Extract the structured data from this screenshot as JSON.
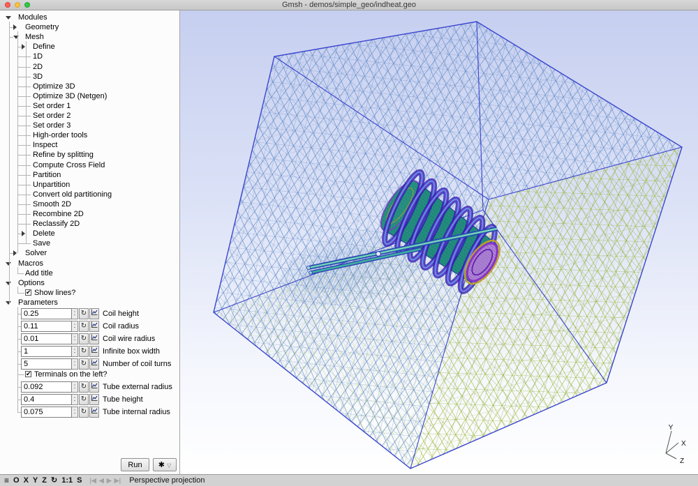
{
  "window": {
    "title": "Gmsh - demos/simple_geo/indheat.geo"
  },
  "icons": {
    "check": "✔",
    "stepper": ":",
    "loop": "↻",
    "gear": "✱",
    "dropdown": "▽",
    "menu": "≡"
  },
  "tree": {
    "items": [
      {
        "label": "Modules",
        "depth": 0,
        "arrow": "expanded"
      },
      {
        "label": "Geometry",
        "depth": 1,
        "arrow": "collapsed"
      },
      {
        "label": "Mesh",
        "depth": 1,
        "arrow": "expanded"
      },
      {
        "label": "Define",
        "depth": 2,
        "arrow": "collapsed"
      },
      {
        "label": "1D",
        "depth": 2,
        "arrow": "none"
      },
      {
        "label": "2D",
        "depth": 2,
        "arrow": "none"
      },
      {
        "label": "3D",
        "depth": 2,
        "arrow": "none"
      },
      {
        "label": "Optimize 3D",
        "depth": 2,
        "arrow": "none"
      },
      {
        "label": "Optimize 3D (Netgen)",
        "depth": 2,
        "arrow": "none"
      },
      {
        "label": "Set order 1",
        "depth": 2,
        "arrow": "none"
      },
      {
        "label": "Set order 2",
        "depth": 2,
        "arrow": "none"
      },
      {
        "label": "Set order 3",
        "depth": 2,
        "arrow": "none"
      },
      {
        "label": "High-order tools",
        "depth": 2,
        "arrow": "none"
      },
      {
        "label": "Inspect",
        "depth": 2,
        "arrow": "none"
      },
      {
        "label": "Refine by splitting",
        "depth": 2,
        "arrow": "none"
      },
      {
        "label": "Compute Cross Field",
        "depth": 2,
        "arrow": "none"
      },
      {
        "label": "Partition",
        "depth": 2,
        "arrow": "none"
      },
      {
        "label": "Unpartition",
        "depth": 2,
        "arrow": "none"
      },
      {
        "label": "Convert old partitioning",
        "depth": 2,
        "arrow": "none"
      },
      {
        "label": "Smooth 2D",
        "depth": 2,
        "arrow": "none"
      },
      {
        "label": "Recombine 2D",
        "depth": 2,
        "arrow": "none"
      },
      {
        "label": "Reclassify 2D",
        "depth": 2,
        "arrow": "none"
      },
      {
        "label": "Delete",
        "depth": 2,
        "arrow": "collapsed"
      },
      {
        "label": "Save",
        "depth": 2,
        "arrow": "none"
      },
      {
        "label": "Solver",
        "depth": 1,
        "arrow": "collapsed"
      },
      {
        "label": "Macros",
        "depth": 0,
        "arrow": "expanded"
      },
      {
        "label": "Add title",
        "depth": 1,
        "arrow": "none"
      },
      {
        "label": "Options",
        "depth": 0,
        "arrow": "expanded"
      },
      {
        "label": "Show lines?",
        "depth": 1,
        "arrow": "none",
        "checkbox": true,
        "checked": true
      },
      {
        "label": "Parameters",
        "depth": 0,
        "arrow": "expanded"
      }
    ]
  },
  "parameters": {
    "items": [
      {
        "type": "field",
        "value": "0.25",
        "label": "Coil height"
      },
      {
        "type": "field",
        "value": "0.11",
        "label": "Coil radius"
      },
      {
        "type": "field",
        "value": "0.01",
        "label": "Coil wire radius"
      },
      {
        "type": "field",
        "value": "1",
        "label": "Infinite box width"
      },
      {
        "type": "field",
        "value": "5",
        "label": "Number of coil turns"
      },
      {
        "type": "checkbox",
        "label": "Terminals on the left?",
        "checked": true
      },
      {
        "type": "field",
        "value": "0.092",
        "label": "Tube external radius"
      },
      {
        "type": "field",
        "value": "0.4",
        "label": "Tube height"
      },
      {
        "type": "field",
        "value": "0.075",
        "label": "Tube internal radius"
      }
    ]
  },
  "actions": {
    "run": "Run",
    "gear_icon": "✱",
    "gear_dropdown_icon": "▽"
  },
  "statusbar": {
    "buttons": [
      {
        "glyph": "≡",
        "name": "menu-icon"
      },
      {
        "glyph": "O",
        "name": "ortho-button"
      },
      {
        "glyph": "X",
        "name": "x-view-button"
      },
      {
        "glyph": "Y",
        "name": "y-view-button"
      },
      {
        "glyph": "Z",
        "name": "z-view-button"
      },
      {
        "glyph": "↻",
        "name": "rotate-view-button"
      },
      {
        "glyph": "1:1",
        "name": "one-to-one-button"
      },
      {
        "glyph": "S",
        "name": "scale-button"
      }
    ],
    "playback": [
      {
        "glyph": "|◀",
        "name": "skip-start-icon"
      },
      {
        "glyph": "◀",
        "name": "step-back-icon"
      },
      {
        "glyph": "▶",
        "name": "play-icon"
      },
      {
        "glyph": "▶|",
        "name": "step-forward-icon"
      }
    ],
    "message": "Perspective projection"
  },
  "viewport": {
    "axis": {
      "x": "X",
      "y": "Y",
      "z": "Z"
    },
    "colors": {
      "background_top": "#c6cff0",
      "background_bottom": "#ffffff",
      "cube_edge": "#3a46cf",
      "mesh_blue": "#5b86c2",
      "mesh_blue_dark": "#4a78b8",
      "mesh_green": "#9dbb3a",
      "mesh_green_dark": "#7d9a2e",
      "mesh_fine": "#4a7ab5",
      "tube": "#2f9e8e",
      "tube_mesh": "#0d6b60",
      "coil_blue": "#2b1fae",
      "coil_purple": "#8243d6",
      "coil_cyan": "#3fc8e8",
      "cap_fill": "#c9b2e2",
      "cap_mesh": "#7a2fb8",
      "cap_ring_yellow": "#bfa02e",
      "rod_edge": "#2a3bb8",
      "rod_fill": "#3fae9f"
    }
  }
}
